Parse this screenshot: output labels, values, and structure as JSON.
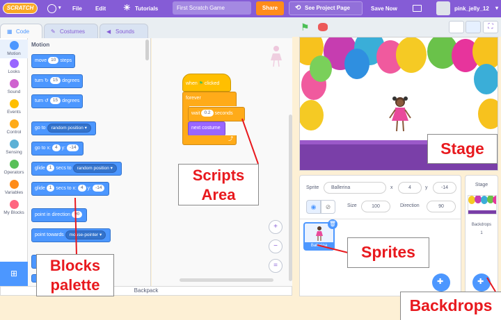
{
  "menubar": {
    "logo": "SCRATCH",
    "file": "File",
    "edit": "Edit",
    "tutorials": "Tutorials",
    "project_title": "First Scratch Game",
    "share": "Share",
    "see_project_page": "See Project Page",
    "save_now": "Save Now",
    "username": "pink_jelly_12"
  },
  "tabs": {
    "code": "Code",
    "costumes": "Costumes",
    "sounds": "Sounds"
  },
  "categories": [
    {
      "label": "Motion",
      "color": "#4c97ff"
    },
    {
      "label": "Looks",
      "color": "#9966ff"
    },
    {
      "label": "Sound",
      "color": "#cf63cf"
    },
    {
      "label": "Events",
      "color": "#ffbf00"
    },
    {
      "label": "Control",
      "color": "#ffab19"
    },
    {
      "label": "Sensing",
      "color": "#5cb1d6"
    },
    {
      "label": "Operators",
      "color": "#59c059"
    },
    {
      "label": "Variables",
      "color": "#ff8c1a"
    },
    {
      "label": "My Blocks",
      "color": "#ff6680"
    }
  ],
  "palette": {
    "heading": "Motion",
    "move": {
      "t1": "move",
      "v": "10",
      "t2": "steps"
    },
    "turn_right": {
      "t1": "turn",
      "v": "15",
      "t2": "degrees"
    },
    "turn_left": {
      "t1": "turn",
      "v": "15",
      "t2": "degrees"
    },
    "goto": {
      "t1": "go to",
      "dd": "random position"
    },
    "goto_xy": {
      "t1": "go to x:",
      "x": "4",
      "t2": "y:",
      "y": "-14"
    },
    "glide_random": {
      "t1": "glide",
      "v": "1",
      "t2": "secs to",
      "dd": "random position"
    },
    "glide_xy": {
      "t1": "glide",
      "v": "1",
      "t2": "secs to x:",
      "x": "4",
      "t3": "y:",
      "y": "-14"
    },
    "point_direction": {
      "t1": "point in direction",
      "v": "90"
    },
    "point_towards": {
      "t1": "point towards",
      "dd": "mouse-pointer"
    }
  },
  "script": {
    "when": "when",
    "clicked": "clicked",
    "forever": "forever",
    "wait": "wait",
    "wait_value": "0.2",
    "seconds": "seconds",
    "next_costume": "next costume"
  },
  "backpack": "Backpack",
  "sprite_info": {
    "sprite_label": "Sprite",
    "sprite_name": "Ballerina",
    "x_label": "x",
    "x": "4",
    "y_label": "y",
    "y": "-14",
    "size_label": "Size",
    "size": "100",
    "direction_label": "Direction",
    "direction": "90"
  },
  "sprite_thumb": "Ballerina",
  "stage_pane": {
    "title": "Stage",
    "backdrops_label": "Backdrops",
    "backdrops_count": "1"
  },
  "callouts": {
    "stage": "Stage",
    "scripts": "Scripts Area",
    "blocks": "Blocks palette",
    "sprites": "Sprites",
    "backdrops": "Backdrops"
  }
}
